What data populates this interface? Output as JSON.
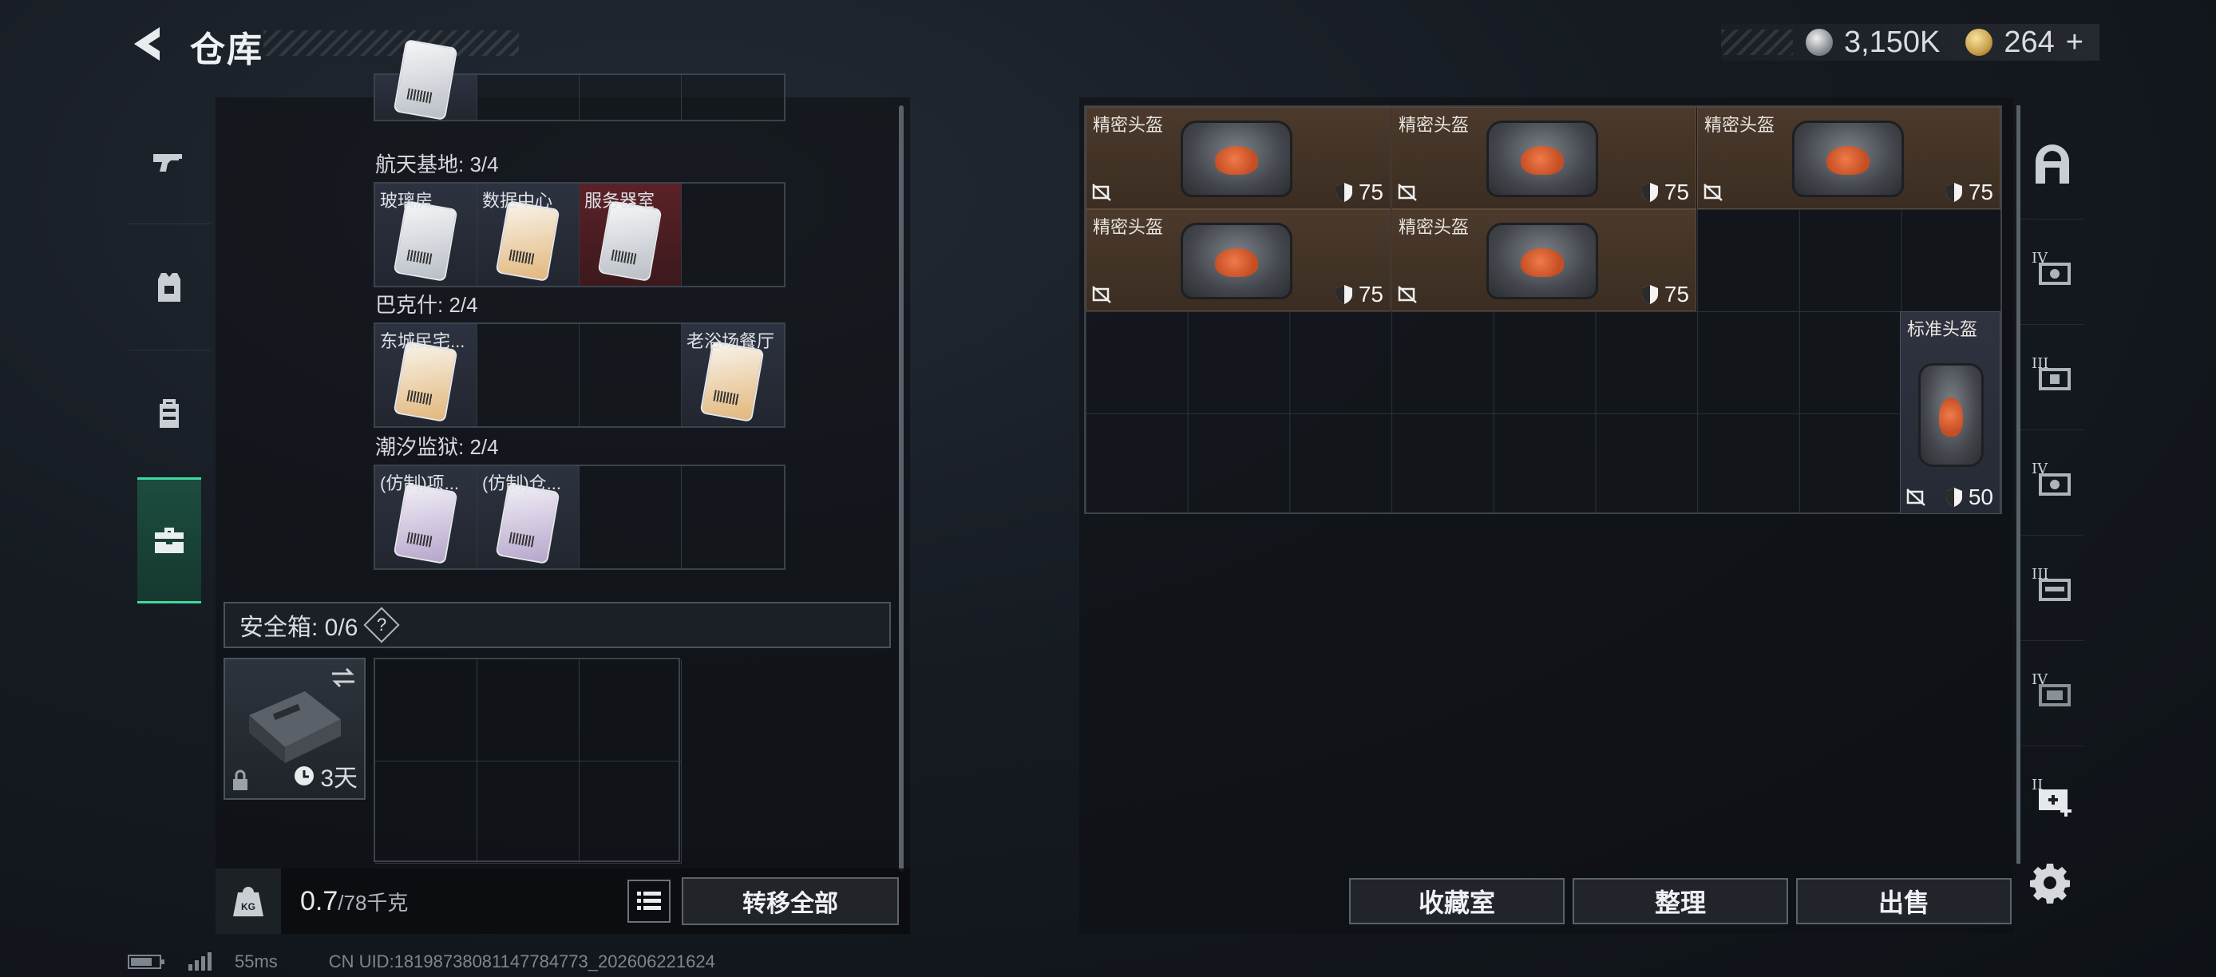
{
  "header": {
    "title": "仓库"
  },
  "currency": {
    "silver": "3,150K",
    "gold": "264",
    "plus": "+"
  },
  "left_tabs": [
    "weapons",
    "armor",
    "backpack",
    "storage"
  ],
  "access_cards": {
    "groups": [
      {
        "label": "航天基地: 3/4",
        "items": [
          "玻璃房",
          "数据中心",
          "服务器室"
        ]
      },
      {
        "label": "巴克什: 2/4",
        "items": [
          "东城民宅...",
          "老浴场餐厅"
        ]
      },
      {
        "label": "潮汐监狱: 2/4",
        "items": [
          "(仿制)项...",
          "(仿制)仓..."
        ]
      }
    ]
  },
  "safe_box": {
    "label": "安全箱: 0/6",
    "help": "?",
    "timer": "3天"
  },
  "weight": {
    "current": "0.7",
    "max": "/78千克"
  },
  "buttons": {
    "transfer_all": "转移全部",
    "collection": "收藏室",
    "organize": "整理",
    "sell": "出售"
  },
  "stash_items": [
    {
      "name": "精密头盔",
      "durability": "75"
    },
    {
      "name": "精密头盔",
      "durability": "75"
    },
    {
      "name": "精密头盔",
      "durability": "75"
    },
    {
      "name": "精密头盔",
      "durability": "75"
    },
    {
      "name": "精密头盔",
      "durability": "75"
    },
    {
      "name": "标准头盔",
      "durability": "50"
    }
  ],
  "right_tabs": [
    {
      "icon": "home-icon",
      "tier": ""
    },
    {
      "icon": "helmet-case-icon",
      "tier": "IV"
    },
    {
      "icon": "helmet-case-icon",
      "tier": "III"
    },
    {
      "icon": "helmet-case-icon",
      "tier": "IV"
    },
    {
      "icon": "helmet-case-icon",
      "tier": "III"
    },
    {
      "icon": "helmet-case-icon",
      "tier": "IV"
    },
    {
      "icon": "add-case-icon",
      "tier": "II"
    }
  ],
  "footer": {
    "ping": "55ms",
    "uid": "CN UID:18198738081147784773_202606221624"
  }
}
